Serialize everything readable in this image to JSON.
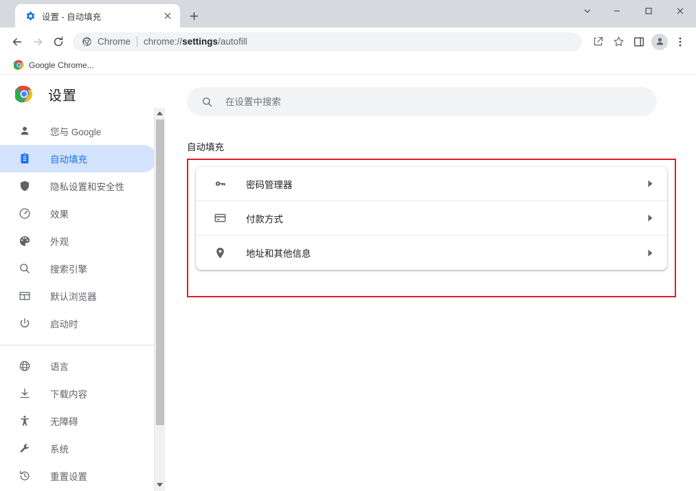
{
  "window": {
    "controls": [
      {
        "name": "tab-search-button",
        "glyph": "chevron-down"
      },
      {
        "name": "minimize-button",
        "glyph": "minimize"
      },
      {
        "name": "maximize-button",
        "glyph": "maximize"
      },
      {
        "name": "close-button",
        "glyph": "close"
      }
    ]
  },
  "tab": {
    "title": "设置 - 自动填充",
    "favicon": "settings-gear-icon",
    "close_label": "×",
    "new_tab_label": "+"
  },
  "toolbar": {
    "back_label": "←",
    "forward_label": "→",
    "reload_label": "⟳",
    "omnibox": {
      "chip": "Chrome",
      "url_prefix": "chrome://",
      "url_bold": "settings",
      "url_suffix": "/autofill",
      "full_url": "chrome://settings/autofill"
    },
    "actions": [
      {
        "name": "share-icon"
      },
      {
        "name": "bookmark-star-icon"
      },
      {
        "name": "side-panel-icon"
      },
      {
        "name": "profile-avatar"
      },
      {
        "name": "more-menu-icon"
      }
    ]
  },
  "bookmarks": {
    "items": [
      {
        "label": "Google Chrome...",
        "icon": "chrome-logo-icon"
      }
    ]
  },
  "settings": {
    "header_title": "设置",
    "logo": "chrome-logo-icon",
    "nav_groups": [
      {
        "items": [
          {
            "label": "您与 Google",
            "icon": "person-icon",
            "active": false
          },
          {
            "label": "自动填充",
            "icon": "clipboard-icon",
            "active": true
          },
          {
            "label": "隐私设置和安全性",
            "icon": "shield-icon",
            "active": false
          },
          {
            "label": "效果",
            "icon": "speedometer-icon",
            "active": false
          },
          {
            "label": "外观",
            "icon": "palette-icon",
            "active": false
          },
          {
            "label": "搜索引擎",
            "icon": "search-icon",
            "active": false
          },
          {
            "label": "默认浏览器",
            "icon": "browser-window-icon",
            "active": false
          },
          {
            "label": "启动时",
            "icon": "power-icon",
            "active": false
          }
        ]
      },
      {
        "items": [
          {
            "label": "语言",
            "icon": "globe-icon",
            "active": false
          },
          {
            "label": "下载内容",
            "icon": "download-icon",
            "active": false
          },
          {
            "label": "无障碍",
            "icon": "accessibility-icon",
            "active": false
          },
          {
            "label": "系统",
            "icon": "wrench-icon",
            "active": false
          },
          {
            "label": "重置设置",
            "icon": "history-restore-icon",
            "active": false
          }
        ]
      }
    ],
    "scrollbar": {
      "up_arrow": "▲",
      "down_arrow": "▼"
    }
  },
  "search": {
    "placeholder": "在设置中搜索",
    "value": "",
    "icon": "search-icon"
  },
  "main": {
    "section_title": "自动填充",
    "highlight_color": "#e01b24",
    "rows": [
      {
        "label": "密码管理器",
        "icon": "key-icon",
        "chevron": "▸"
      },
      {
        "label": "付款方式",
        "icon": "credit-card-icon",
        "chevron": "▸"
      },
      {
        "label": "地址和其他信息",
        "icon": "location-pin-icon",
        "chevron": "▸"
      }
    ]
  },
  "colors": {
    "accent_blue": "#1a73e8",
    "active_pill": "#d3e3fd",
    "annotation_red": "#e01b24",
    "chrome_frame": "#d6dadf"
  }
}
